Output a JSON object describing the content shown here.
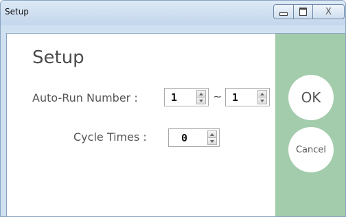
{
  "window": {
    "title": "Setup"
  },
  "titlebar": {
    "minimize_icon": "minimize-icon",
    "maximize_icon": "maximize-icon",
    "close_icon": "close-icon",
    "close_glyph": "X"
  },
  "form": {
    "heading": "Setup",
    "auto_run_label": "Auto-Run Number :",
    "auto_run_from": "1",
    "range_separator": "~",
    "auto_run_to": "1",
    "cycle_label": "Cycle Times :",
    "cycle_value": "0"
  },
  "actions": {
    "ok_label": "OK",
    "cancel_label": "Cancel"
  },
  "colors": {
    "side_panel": "#a3ccac",
    "titlebar": "#cfe0f1"
  }
}
